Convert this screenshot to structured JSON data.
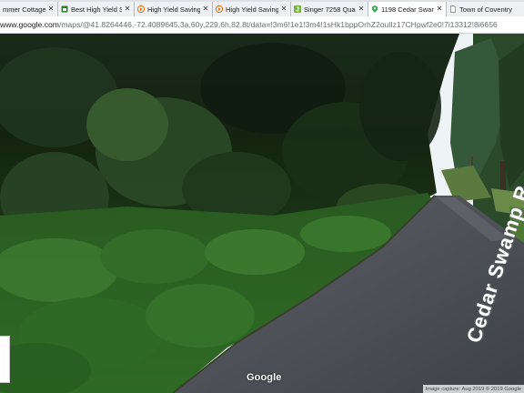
{
  "browser": {
    "tabs": [
      {
        "label": "mmer Cottage ·",
        "icon": "page-icon",
        "active": false
      },
      {
        "label": "Best High Yield Sa",
        "icon": "bank-icon",
        "active": false
      },
      {
        "label": "High Yield Saving:",
        "icon": "play-icon",
        "active": false
      },
      {
        "label": "High Yield Saving:",
        "icon": "play-icon",
        "active": false
      },
      {
        "label": "Singer 7258 Quan",
        "icon": "j-icon",
        "active": false
      },
      {
        "label": "1198 Cedar Swam",
        "icon": "maps-icon",
        "active": true
      },
      {
        "label": "Town of Coventry",
        "icon": "page-icon",
        "active": false
      }
    ],
    "url_domain": "www.google.com",
    "url_path": "/maps/@41.8264446,-72.4089645,3a,60y,229.6h,82.8t/data=!3m6!1e1!3m4!1sHk1bppOrhZ2oulIz17CHpwf2e0!7i13312!8i6656"
  },
  "streetview": {
    "road_label": "Cedar Swamp R",
    "logo": "Google",
    "attribution": "Image capture: Aug 2019   © 2019 Google"
  },
  "colors": {
    "tab_bg": "#dee1e6",
    "active_tab": "#ffffff",
    "road": "#4f5257",
    "foliage_dark": "#142314",
    "sky": "#eef3f6"
  }
}
